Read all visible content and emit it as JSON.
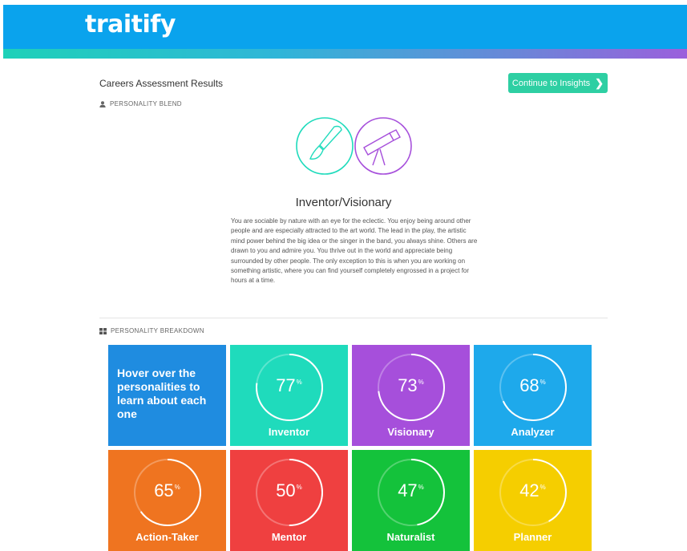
{
  "header": {
    "logo": "traitify",
    "brand_color": "#0aa3ed"
  },
  "page": {
    "title": "Careers Assessment Results",
    "continue_label": "Continue to Insights",
    "continue_icon": "chevron-right-icon",
    "accent": "#2ecfa3"
  },
  "blend": {
    "section_label": "PERSONALITY BLEND",
    "section_icon": "user-icon",
    "name": "Inventor/Visionary",
    "icons": [
      "paintbrush-icon",
      "telescope-icon"
    ],
    "description": "You are sociable by nature with an eye for the eclectic. You enjoy being around other people and are especially attracted to the art world. The lead in the play, the artistic mind power behind the big idea or the singer in the band, you always shine. Others are drawn to you and admire you. You thrive out in the world and appreciate being surrounded by other people. The only exception to this is when you are working on something artistic, where you can find yourself completely engrossed in a project for hours at a time."
  },
  "breakdown": {
    "section_label": "PERSONALITY BREAKDOWN",
    "section_icon": "grid-icon",
    "intro": "Hover over the personalities to learn about each one",
    "intro_color": "#1f8ce0",
    "types": [
      {
        "name": "Inventor",
        "percent": 77,
        "color": "#1fdbbc"
      },
      {
        "name": "Visionary",
        "percent": 73,
        "color": "#a64fdb"
      },
      {
        "name": "Analyzer",
        "percent": 68,
        "color": "#1ea9eb"
      },
      {
        "name": "Action-Taker",
        "percent": 65,
        "color": "#ef7420"
      },
      {
        "name": "Mentor",
        "percent": 50,
        "color": "#ef4040"
      },
      {
        "name": "Naturalist",
        "percent": 47,
        "color": "#14c23b"
      },
      {
        "name": "Planner",
        "percent": 42,
        "color": "#f5ce00"
      }
    ]
  }
}
